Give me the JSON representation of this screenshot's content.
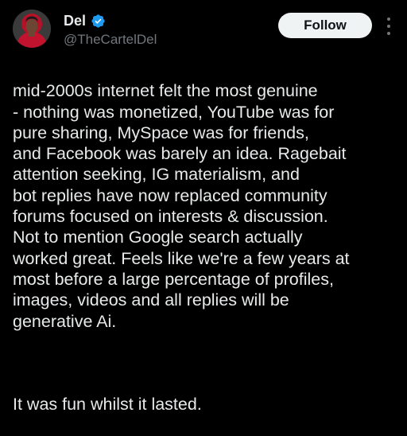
{
  "author": {
    "display_name": "Del",
    "handle": "@TheCartelDel",
    "verified": true,
    "avatar_icon": "user-avatar-red-hoodie"
  },
  "actions": {
    "follow_label": "Follow",
    "more_icon": "more-vertical-icon"
  },
  "post": {
    "paragraph_1": "mid-2000s internet felt the most genuine\n- nothing was monetized, YouTube was for\npure sharing, MySpace was for friends,\nand Facebook was barely an idea. Ragebait\nattention seeking, IG materialism, and\nbot replies have now replaced community\nforums focused on interests & discussion.\nNot to mention Google search actually\nworked great. Feels like we're a few years at\nmost before a large percentage of profiles,\nimages, videos and all replies will be\ngenerative Ai.",
    "paragraph_2": "It was fun whilst it lasted."
  },
  "colors": {
    "background": "#000000",
    "text": "#e7e9ea",
    "secondary_text": "#71767b",
    "verified_badge": "#1d9bf0",
    "follow_button_bg": "#eff3f4",
    "follow_button_text": "#0f1419"
  }
}
